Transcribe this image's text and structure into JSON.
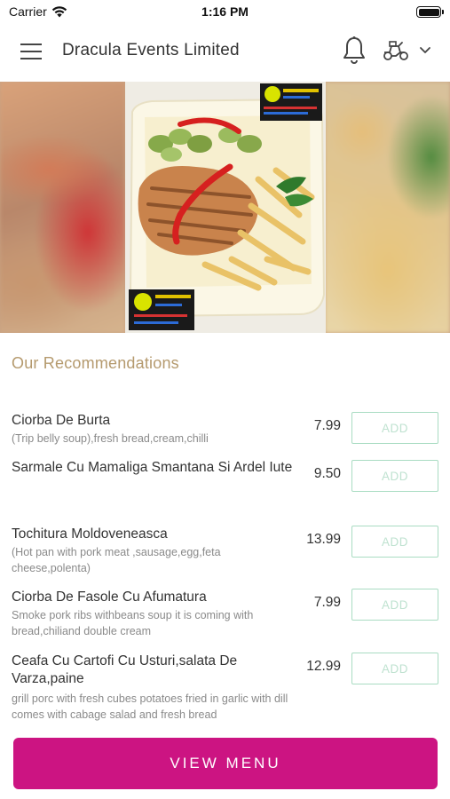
{
  "status_bar": {
    "carrier": "Carrier",
    "time": "1:16 PM"
  },
  "header": {
    "title": "Dracula Events Limited",
    "icons": [
      "menu-icon",
      "bell-icon",
      "delivery-scooter-icon",
      "chevron-down-icon"
    ]
  },
  "recommendations": {
    "title": "Our Recommendations",
    "items": [
      {
        "name": "Ciorba De Burta",
        "description": "(Trip belly soup),fresh bread,cream,chilli",
        "price": "7.99",
        "add_label": "ADD"
      },
      {
        "name": "Sarmale Cu Mamaliga Smantana Si Ardel Iute",
        "description": "",
        "price": "9.50",
        "add_label": "ADD"
      },
      {
        "name": "Tochitura Moldoveneasca",
        "description": "(Hot pan with pork meat ,sausage,egg,feta cheese,polenta)",
        "price": "13.99",
        "add_label": "ADD"
      },
      {
        "name": "Ciorba De Fasole Cu Afumatura",
        "description": "Smoke pork ribs withbeans soup it is coming with bread,chiliand double cream",
        "price": "7.99",
        "add_label": "ADD"
      },
      {
        "name": "Ceafa Cu Cartofi Cu Usturi,salata De Varza,paine",
        "description": "grill porc with fresh cubes potatoes fried in garlic with dill comes with cabage salad and fresh bread",
        "price": "12.99",
        "add_label": "ADD"
      }
    ]
  },
  "footer": {
    "view_menu_label": "VIEW MENU"
  },
  "colors": {
    "accent": "#cc1482",
    "section_title": "#b59a6e",
    "add_border": "#a9dcc2"
  }
}
